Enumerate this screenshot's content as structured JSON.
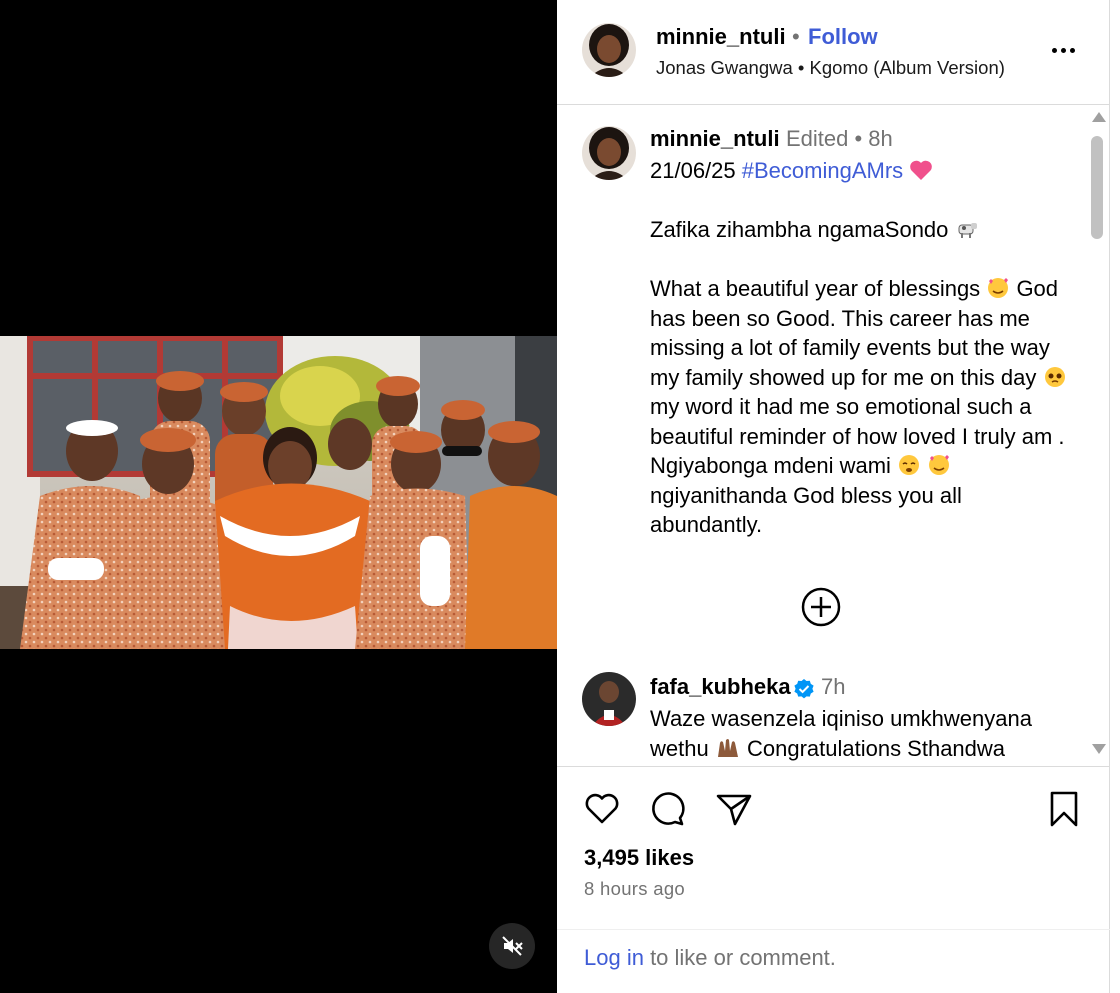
{
  "post": {
    "username": "minnie_ntuli",
    "follow_label": "Follow",
    "separator": "•",
    "audio": "Jonas Gwangwa • Kgomo (Album Version)",
    "more_icon": "more-horizontal-icon"
  },
  "caption": {
    "username": "minnie_ntuli",
    "meta": "Edited •  8h",
    "date": "21/06/25",
    "hashtag": "#BecomingAMrs",
    "line_1": "Zafika zihambha ngamaSondo",
    "para_2_a": "What a beautiful year of blessings",
    "para_2_b": "God has been so Good. This career has me missing a lot of family events but the way my family showed up for me on this day",
    "para_2_c": "my word it had me so emotional such a beautiful reminder of how loved I truly am . Ngiyabonga mdeni wami",
    "para_2_d": "ngiyanithanda God bless you all abundantly."
  },
  "comment": {
    "username": "fafa_kubheka",
    "time": "7h",
    "text_a": "Waze wasenzela iqiniso umkhwenyana wethu",
    "text_b": "Congratulations Sthandwa"
  },
  "actions": {
    "likes": "3,495 likes",
    "time_ago": "8 hours ago",
    "login_link": "Log in",
    "login_rest": " to like or comment."
  },
  "colors": {
    "link_blue": "#3f5cd6",
    "muted_gray": "#737373",
    "divider": "#dbdbdb",
    "heart_emoji": "#f0508c",
    "verified_blue": "#0095f6"
  }
}
